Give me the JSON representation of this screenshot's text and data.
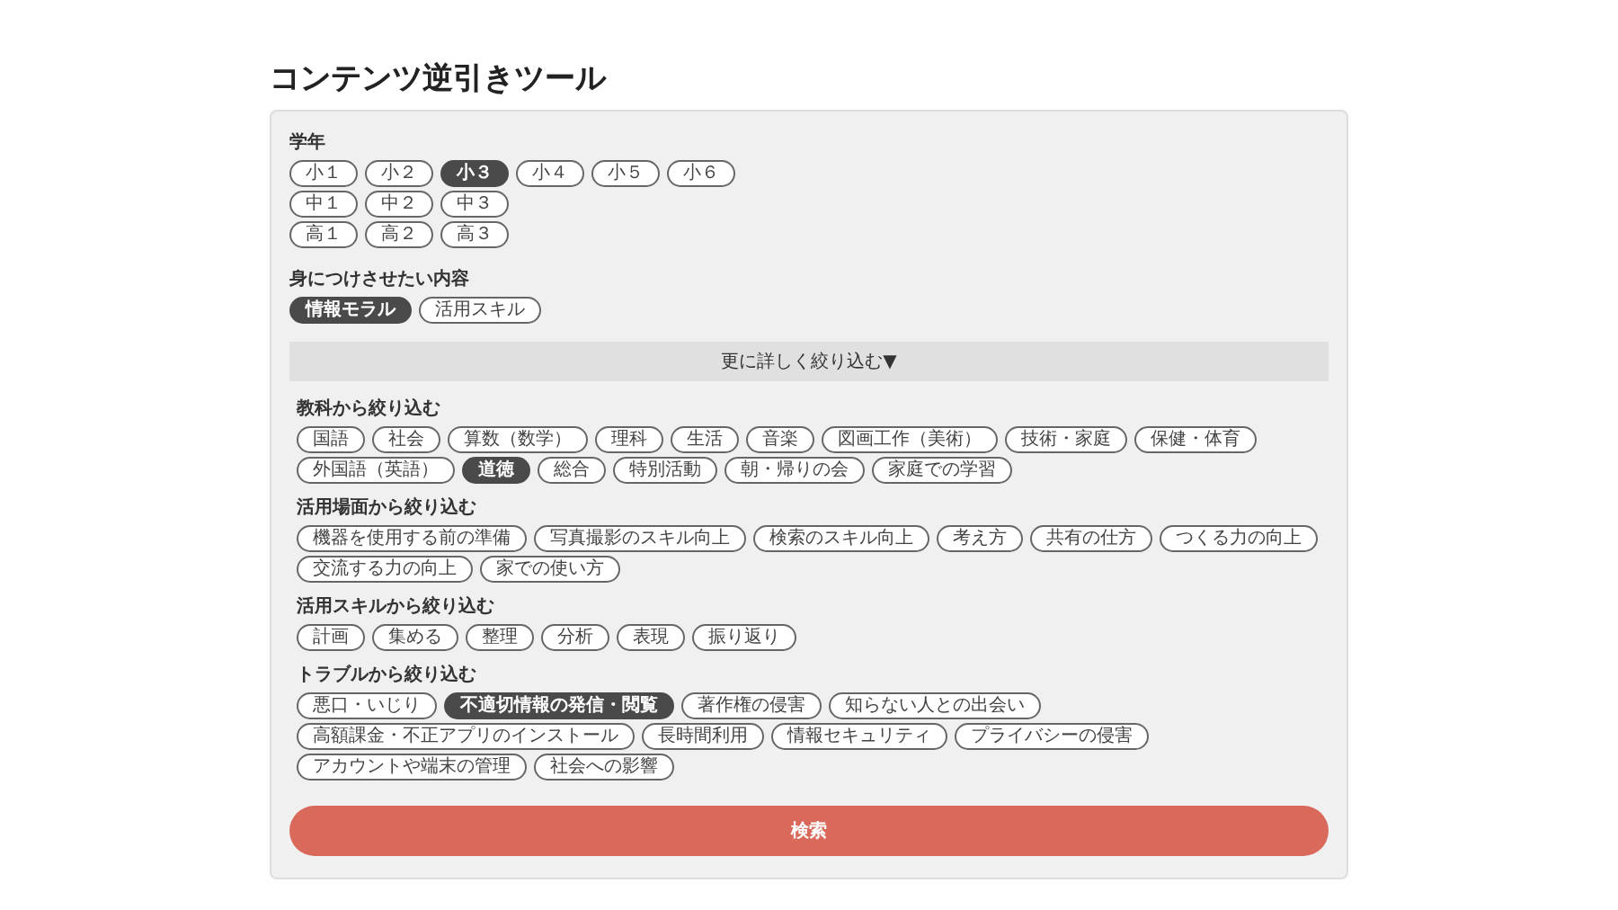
{
  "title": "コンテンツ逆引きツール",
  "top_sections": [
    {
      "heading": "学年",
      "rows": [
        [
          {
            "label": "小１",
            "selected": false
          },
          {
            "label": "小２",
            "selected": false
          },
          {
            "label": "小３",
            "selected": true
          },
          {
            "label": "小４",
            "selected": false
          },
          {
            "label": "小５",
            "selected": false
          },
          {
            "label": "小６",
            "selected": false
          }
        ],
        [
          {
            "label": "中１",
            "selected": false
          },
          {
            "label": "中２",
            "selected": false
          },
          {
            "label": "中３",
            "selected": false
          }
        ],
        [
          {
            "label": "高１",
            "selected": false
          },
          {
            "label": "高２",
            "selected": false
          },
          {
            "label": "高３",
            "selected": false
          }
        ]
      ]
    },
    {
      "heading": "身につけさせたい内容",
      "rows": [
        [
          {
            "label": "情報モラル",
            "selected": true
          },
          {
            "label": "活用スキル",
            "selected": false
          }
        ]
      ]
    }
  ],
  "expand_button": "更に詳しく絞り込む▼",
  "filter_sections": [
    {
      "heading": "教科から絞り込む",
      "options": [
        {
          "label": "国語",
          "selected": false
        },
        {
          "label": "社会",
          "selected": false
        },
        {
          "label": "算数（数学）",
          "selected": false
        },
        {
          "label": "理科",
          "selected": false
        },
        {
          "label": "生活",
          "selected": false
        },
        {
          "label": "音楽",
          "selected": false
        },
        {
          "label": "図画工作（美術）",
          "selected": false
        },
        {
          "label": "技術・家庭",
          "selected": false
        },
        {
          "label": "保健・体育",
          "selected": false
        },
        {
          "label": "外国語（英語）",
          "selected": false
        },
        {
          "label": "道徳",
          "selected": true
        },
        {
          "label": "総合",
          "selected": false
        },
        {
          "label": "特別活動",
          "selected": false
        },
        {
          "label": "朝・帰りの会",
          "selected": false
        },
        {
          "label": "家庭での学習",
          "selected": false
        }
      ]
    },
    {
      "heading": "活用場面から絞り込む",
      "options": [
        {
          "label": "機器を使用する前の準備",
          "selected": false
        },
        {
          "label": "写真撮影のスキル向上",
          "selected": false
        },
        {
          "label": "検索のスキル向上",
          "selected": false
        },
        {
          "label": "考え方",
          "selected": false
        },
        {
          "label": "共有の仕方",
          "selected": false
        },
        {
          "label": "つくる力の向上",
          "selected": false
        },
        {
          "label": "交流する力の向上",
          "selected": false
        },
        {
          "label": "家での使い方",
          "selected": false
        }
      ]
    },
    {
      "heading": "活用スキルから絞り込む",
      "options": [
        {
          "label": "計画",
          "selected": false
        },
        {
          "label": "集める",
          "selected": false
        },
        {
          "label": "整理",
          "selected": false
        },
        {
          "label": "分析",
          "selected": false
        },
        {
          "label": "表現",
          "selected": false
        },
        {
          "label": "振り返り",
          "selected": false
        }
      ]
    },
    {
      "heading": "トラブルから絞り込む",
      "options": [
        {
          "label": "悪口・いじり",
          "selected": false
        },
        {
          "label": "不適切情報の発信・閲覧",
          "selected": true
        },
        {
          "label": "著作権の侵害",
          "selected": false
        },
        {
          "label": "知らない人との出会い",
          "selected": false
        },
        {
          "label": "高額課金・不正アプリのインストール",
          "selected": false
        },
        {
          "label": "長時間利用",
          "selected": false
        },
        {
          "label": "情報セキュリティ",
          "selected": false
        },
        {
          "label": "プライバシーの侵害",
          "selected": false
        },
        {
          "label": "アカウントや端末の管理",
          "selected": false
        },
        {
          "label": "社会への影響",
          "selected": false
        }
      ]
    }
  ],
  "search_button": "検索"
}
